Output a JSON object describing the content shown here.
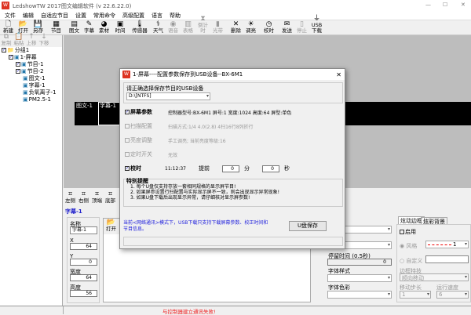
{
  "title": "LedshowTW 2017图文编辑软件 (v 22.6.22.0)",
  "window_controls": {
    "minimize": "—",
    "maximize": "☐",
    "close": "✕"
  },
  "menu": [
    "文件",
    "编辑",
    "自适应节目",
    "设置",
    "常用命令",
    "高级配置",
    "语言",
    "帮助"
  ],
  "toolbar": [
    {
      "label": "新建",
      "icon": "new-file",
      "g": "🗋"
    },
    {
      "label": "打开",
      "icon": "open-folder",
      "g": "📂"
    },
    {
      "label": "另存",
      "icon": "save",
      "g": "💾"
    },
    {
      "label": "节目",
      "icon": "program",
      "g": "▦"
    },
    {
      "label": "图文",
      "icon": "image-text",
      "g": "▤"
    },
    {
      "label": "字幕",
      "icon": "subtitle",
      "g": "✎"
    },
    {
      "label": "素材",
      "icon": "material",
      "g": "◕"
    },
    {
      "label": "时间",
      "icon": "clock",
      "g": "▣"
    },
    {
      "label": "传感器",
      "icon": "sensor",
      "g": "🌡"
    },
    {
      "label": "天气",
      "icon": "weather",
      "g": "⚕"
    },
    {
      "label": "语音",
      "icon": "voice",
      "g": "◉",
      "disabled": true
    },
    {
      "label": "表格",
      "icon": "table",
      "g": "▥",
      "disabled": true
    },
    {
      "label": "倒计时",
      "icon": "countdown",
      "g": "⧗",
      "disabled": true
    },
    {
      "label": "光带",
      "icon": "light-band",
      "g": "▮",
      "disabled": true
    },
    {
      "label": "删除",
      "icon": "delete",
      "g": "✕"
    },
    {
      "label": "调亮",
      "icon": "brightness",
      "g": "☀"
    },
    {
      "label": "校时",
      "icon": "time-sync",
      "g": "◷"
    },
    {
      "label": "发送",
      "icon": "send",
      "g": "✉"
    },
    {
      "label": "停止",
      "icon": "stop",
      "g": "▯",
      "disabled": true
    },
    {
      "label": "USB下载",
      "icon": "usb",
      "g": "⏚"
    }
  ],
  "toolbar2": [
    "复制",
    "粘贴",
    "上移",
    "下移"
  ],
  "tree": [
    {
      "label": "分组1",
      "level": 0
    },
    {
      "label": "1-屏幕",
      "level": 1
    },
    {
      "label": "节目-1",
      "level": 2
    },
    {
      "label": "节目-2",
      "level": 2
    },
    {
      "label": "图文-1",
      "level": 3
    },
    {
      "label": "字幕-1",
      "level": 3
    },
    {
      "label": "负氧离子-1",
      "level": 3
    },
    {
      "label": "PM2.5-1",
      "level": 3
    }
  ],
  "canvas": {
    "area1": "图文-1",
    "area2": "字幕-1"
  },
  "dialog": {
    "title": "1-屏幕----配置参数保存到USB设备--BX-6M1",
    "usb_label": "请正确选择保存节目的USB设备",
    "usb_value": "D:\\[NTFS]",
    "screen_params": {
      "label": "屏幕参数",
      "checked": true,
      "value": "控制器型号:BX-6M1   屏号:1   宽度:1024   高度:64   屏型:单色"
    },
    "scan_config": {
      "label": "扫描配置",
      "checked": false,
      "value": "扫描方式:1/4    4.0(2.8)  4扫16行8列折行"
    },
    "brightness": {
      "label": "亮度调整",
      "checked": false,
      "value": "手工调亮; 当前亮度等级:16"
    },
    "timer_switch": {
      "label": "定时开关",
      "checked": false,
      "value": "无效"
    },
    "time_sync": {
      "label": "校时",
      "checked": true,
      "time": "11:12:37",
      "advance_label": "提前",
      "minutes": "0",
      "min_unit": "分",
      "seconds": "0",
      "sec_unit": "秒"
    },
    "notice_title": "特别提醒",
    "notices": [
      "1. 每个U盘仅支持存放一套相同规格的显示屏节目!",
      "2. 如果屏参设置行扫配置与实际显示屏不一致，则会出现显示异常现象!",
      "3. 如果U盘下载后出现显示异常，请仔细核对显示屏参数!"
    ],
    "info": "当前<网络通讯>模式下，USB下载只支持下载屏幕参数、校正时间和节目信息。",
    "save_button": "U盘保存"
  },
  "align_tools": [
    "左侧",
    "右侧",
    "顶端",
    "底部"
  ],
  "selected_area": "字幕-1",
  "props": {
    "name_label": "名称",
    "name": "字幕-1",
    "x_label": "X",
    "x": "64",
    "y_label": "Y",
    "y": "0",
    "w_label": "宽度",
    "w": "64",
    "h_label": "高度",
    "h": "56"
  },
  "edit_tools": [
    "打开",
    "字幕"
  ],
  "text_props": {
    "stay_label": "停留时间 (0.5秒)",
    "stay": "0",
    "font_style_label": "字体样式",
    "font_color_label": "字体色彩"
  },
  "border_tabs": [
    "炫动边框",
    "炫彩背景"
  ],
  "border": {
    "enable": "启用",
    "style_label": "风格",
    "style_value": "1",
    "custom_label": "自定义",
    "feature_label": "边框特技",
    "feature_value": "顺向移动",
    "step_label": "移动步长",
    "step": "1",
    "speed_label": "运行速度",
    "speed": "6"
  },
  "status": "与控制器建立通讯失败!"
}
